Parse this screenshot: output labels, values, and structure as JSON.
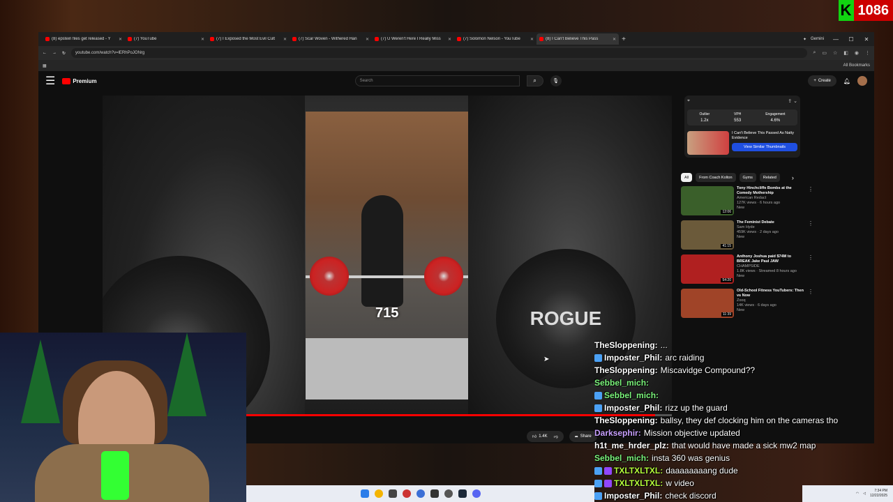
{
  "overlay": {
    "k_letter": "K",
    "count": "1086"
  },
  "browser": {
    "tabs": [
      {
        "label": "(8) epstein files get released - Y"
      },
      {
        "label": "(7) YouTube"
      },
      {
        "label": "(7) I Exposed the Most Evil Cult"
      },
      {
        "label": "(7) Scar Woven - Withered Han"
      },
      {
        "label": "(7) U Weren't Here I Really Miss"
      },
      {
        "label": "(7) Solomon Nelson - YouTube"
      },
      {
        "label": "(8) I Can't Believe This Pass"
      }
    ],
    "gemini_label": "Gemini",
    "url": "youtube.com/watch?v=lERhPoJONrg",
    "bookmarks_label": "All Bookmarks"
  },
  "youtube": {
    "premium_label": "Premium",
    "search_placeholder": "Search",
    "create_label": "Create",
    "video": {
      "rep_count": "715",
      "progress": 0.97
    },
    "likes": "1.4K",
    "share_label": "Share"
  },
  "extension": {
    "stats": [
      {
        "label": "Outlier",
        "value": "1.2x"
      },
      {
        "label": "VPH",
        "value": "553"
      },
      {
        "label": "Engagement",
        "value": "4.6%"
      }
    ],
    "card_title": "I Can't Believe This Passed As Natty Evidence",
    "similar_label": "View Similar Thumbnails"
  },
  "chips": [
    "All",
    "From Coach Kolton",
    "Gyms",
    "Related"
  ],
  "recommendations": [
    {
      "title": "Tony Hinchcliffe Bombs at the Comedy Mothership",
      "channel": "American Redact",
      "views": "127K views · 6 hours ago",
      "badge": "New",
      "duration": "12:06",
      "color": "#3a5f2a"
    },
    {
      "title": "The Feminist Debate",
      "channel": "Sam Hyde",
      "views": "459K views · 2 days ago",
      "badge": "New",
      "duration": "41:15",
      "color": "#6b5a3a"
    },
    {
      "title": "Anthony Joshua paid $74M to BREAK Jake Paul JAW",
      "channel": "CHAMPSIDE",
      "views": "1.8K views · Streamed 8 hours ago",
      "badge": "New",
      "duration": "54:20",
      "color": "#b02020"
    },
    {
      "title": "Old-School Fitness YouTubers: Then vs Now",
      "channel": "Zooq",
      "views": "14K views · 6 days ago",
      "badge": "New",
      "duration": "11:39",
      "color": "#a04428"
    }
  ],
  "chat": [
    {
      "name": "TheSloppening",
      "text": "...",
      "color": "#ffffff",
      "badge": "none"
    },
    {
      "name": "Imposter_Phil",
      "text": "arc raiding",
      "color": "#ffffff",
      "badge": "blue"
    },
    {
      "name": "TheSloppening",
      "text": "Miscavidge Compound??",
      "color": "#ffffff",
      "badge": "none"
    },
    {
      "name": "Sebbel_mich",
      "text": "",
      "color": "#7cf57c",
      "badge": "none"
    },
    {
      "name": "Sebbel_mich",
      "text": "",
      "color": "#7cf57c",
      "badge": "blue"
    },
    {
      "name": "Imposter_Phil",
      "text": "rizz up the guard",
      "color": "#ffffff",
      "badge": "blue"
    },
    {
      "name": "TheSloppening",
      "text": "ballsy, they def clocking him on the cameras tho",
      "color": "#ffffff",
      "badge": "none"
    },
    {
      "name": "Darksephir",
      "text": "Mission objective updated",
      "color": "#c8a0ff",
      "badge": "none"
    },
    {
      "name": "h1t_me_hrder_plz",
      "text": "that would have made a sick mw2 map",
      "color": "#ffffff",
      "badge": "none"
    },
    {
      "name": "Sebbel_mich",
      "text": "insta 360 was genius",
      "color": "#7cf57c",
      "badge": "none"
    },
    {
      "name": "TXLTXLTXL",
      "text": "daaaaaaaang dude",
      "color": "#b7ff3b",
      "badge": "purple"
    },
    {
      "name": "TXLTXLTXL",
      "text": "w video",
      "color": "#b7ff3b",
      "badge": "purple"
    },
    {
      "name": "Imposter_Phil",
      "text": "check discord",
      "color": "#ffffff",
      "badge": "blue"
    }
  ],
  "tray": {
    "time": "7:34 PM",
    "date": "12/22/2025"
  }
}
